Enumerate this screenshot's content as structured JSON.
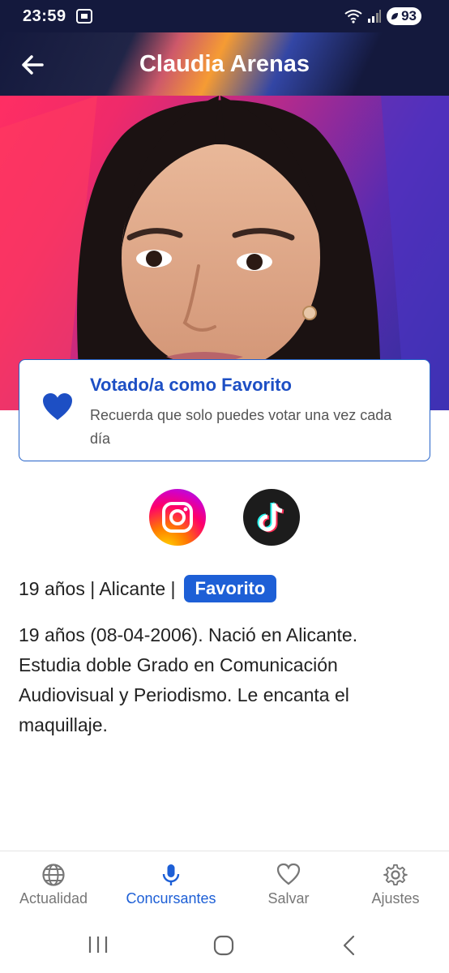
{
  "status_bar": {
    "time": "23:59",
    "battery": "93"
  },
  "app_bar": {
    "title": "Claudia Arenas"
  },
  "vote_card": {
    "title": "Votado/a como Favorito",
    "subtitle": "Recuerda que solo puedes votar una vez cada día"
  },
  "social": {
    "instagram_icon": "instagram-icon",
    "tiktok_icon": "tiktok-icon"
  },
  "info": {
    "summary": "19 años | Alicante |",
    "badge": "Favorito"
  },
  "bio": "19 años (08-04-2006). Nació en Alicante. Estudia doble Grado en Comunicación Audiovisual y Periodismo. Le encanta el maquillaje.",
  "bottom_nav": {
    "items": [
      {
        "label": "Actualidad",
        "icon": "globe-icon",
        "active": false
      },
      {
        "label": "Concursantes",
        "icon": "microphone-icon",
        "active": true
      },
      {
        "label": "Salvar",
        "icon": "heart-outline-icon",
        "active": false
      },
      {
        "label": "Ajustes",
        "icon": "gear-icon",
        "active": false
      }
    ]
  },
  "colors": {
    "accent": "#1d5fd6",
    "status_bar": "#14193d",
    "card_border": "#2563c9"
  }
}
